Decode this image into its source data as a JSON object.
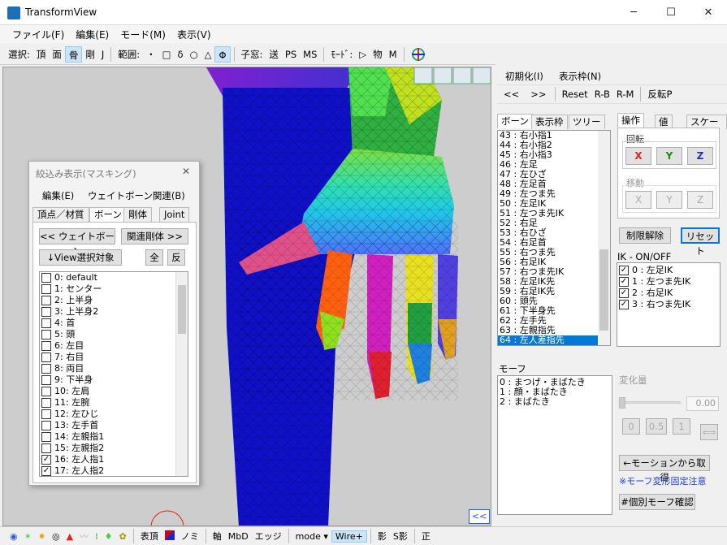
{
  "window": {
    "title": "TransformView",
    "minimize": "─",
    "maximize": "☐",
    "close": "✕"
  },
  "menu": [
    "ファイル(F)",
    "編集(E)",
    "モード(M)",
    "表示(V)"
  ],
  "toolbar": {
    "select_label": "選択:",
    "select_items": [
      "頂",
      "面",
      "骨",
      "剛",
      "J"
    ],
    "range_label": "範囲:",
    "range_items": [
      "・",
      "□",
      "δ",
      "○",
      "△",
      "Φ"
    ],
    "window_label": "子窓:",
    "window_items": [
      "送",
      "PS",
      "MS"
    ],
    "mode_label": "ﾓｰﾄﾞ:",
    "mode_items": [
      "▷",
      "物",
      "M"
    ]
  },
  "mask_window": {
    "title": "絞込み表示(マスキング)",
    "close": "✕",
    "menu": [
      "編集(E)",
      "ウェイトボーン関連(B)"
    ],
    "tabs": [
      "頂点／材質",
      "ボーン",
      "剛体",
      "Joint"
    ],
    "buttons": {
      "weight_bone": "<< ウェイトボーン",
      "related_rigid": "関連剛体 >>",
      "view_select": "↓View選択対象",
      "all": "全",
      "invert": "反"
    },
    "bones": [
      {
        "label": "0: default",
        "checked": false
      },
      {
        "label": "1: センター",
        "checked": false
      },
      {
        "label": "2: 上半身",
        "checked": false
      },
      {
        "label": "3: 上半身2",
        "checked": false
      },
      {
        "label": "4: 首",
        "checked": false
      },
      {
        "label": "5: 頭",
        "checked": false
      },
      {
        "label": "6: 左目",
        "checked": false
      },
      {
        "label": "7: 右目",
        "checked": false
      },
      {
        "label": "8: 両目",
        "checked": false
      },
      {
        "label": "9: 下半身",
        "checked": false
      },
      {
        "label": "10: 左肩",
        "checked": false
      },
      {
        "label": "11: 左腕",
        "checked": false
      },
      {
        "label": "12: 左ひじ",
        "checked": false
      },
      {
        "label": "13: 左手首",
        "checked": false
      },
      {
        "label": "14: 左親指1",
        "checked": false
      },
      {
        "label": "15: 左親指2",
        "checked": false
      },
      {
        "label": "16: 左人指1",
        "checked": true
      },
      {
        "label": "17: 左人指2",
        "checked": true
      }
    ]
  },
  "right_panel": {
    "menu": [
      "初期化(I)",
      "表示枠(N)"
    ],
    "nav": [
      "<<",
      ">>",
      "Reset",
      "R-B",
      "R-M",
      "反転P"
    ],
    "list_tabs": [
      "ボーン",
      "表示枠",
      "ツリー"
    ],
    "bone_list": [
      "43 : 右小指1",
      "44 : 右小指2",
      "45 : 右小指3",
      "46 : 左足",
      "47 : 左ひざ",
      "48 : 左足首",
      "49 : 左つま先",
      "50 : 左足IK",
      "51 : 左つま先IK",
      "52 : 右足",
      "53 : 右ひざ",
      "54 : 右足首",
      "55 : 右つま先",
      "56 : 右足IK",
      "57 : 右つま先IK",
      "58 : 左足IK先",
      "59 : 右足IK先",
      "60 : 頭先",
      "61 : 下半身先",
      "62 : 左手先",
      "63 : 左親指先",
      "64 : 左人差指先"
    ],
    "op_tabs": [
      "操作",
      "値",
      "スケール"
    ],
    "rotate_label": "回転",
    "move_label": "移動",
    "rot_axes": [
      "X",
      "Y",
      "Z"
    ],
    "move_axes": [
      "X",
      "Y",
      "Z"
    ],
    "limit_release": "制限解除",
    "reset": "リセット",
    "ik_label": "IK - ON/OFF",
    "ik_items": [
      "0 : 左足IK",
      "1 : 左つま先IK",
      "2 : 右足IK",
      "3 : 右つま先IK"
    ],
    "morph_label": "モーフ",
    "morphs": [
      "0 : まつげ・まばたき",
      "1 : 顔・まばたき",
      "2 : まばたき"
    ],
    "change_label": "変化量",
    "change_value": "0.00",
    "change_buttons": [
      "0",
      "0.5",
      "1"
    ],
    "from_motion": "←モーションから取得",
    "morph_note": "※モーフ変形固定注意",
    "individual_morph": "#個別モーフ確認",
    "collapse": "<<"
  },
  "statusbar": {
    "items": [
      "表頂",
      "ノミ",
      "軸",
      "MbD",
      "エッジ",
      "mode",
      "Wire+",
      "影",
      "S影",
      "正"
    ]
  },
  "colors": {
    "accent": "#0078d7",
    "rot_x": "#e02020",
    "rot_y": "#1a8a1a",
    "rot_z": "#2030c0",
    "body": "#1010c8"
  }
}
